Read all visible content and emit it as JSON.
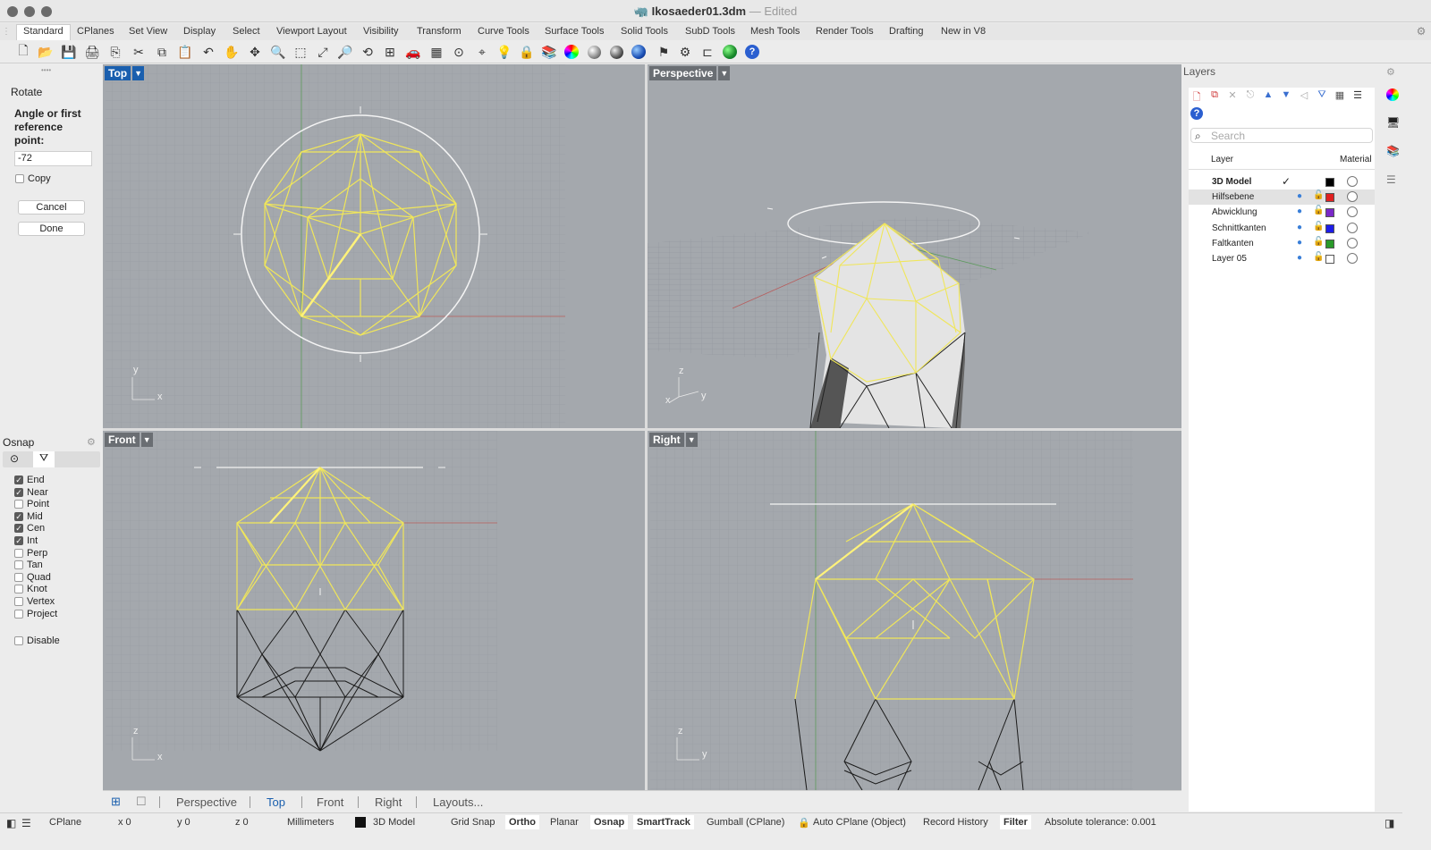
{
  "window": {
    "title": "Ikosaeder01.3dm",
    "status": "Edited"
  },
  "tabs": [
    "Standard",
    "CPlanes",
    "Set View",
    "Display",
    "Select",
    "Viewport Layout",
    "Visibility",
    "Transform",
    "Curve Tools",
    "Surface Tools",
    "Solid Tools",
    "SubD Tools",
    "Mesh Tools",
    "Render Tools",
    "Drafting",
    "New in V8"
  ],
  "command": {
    "name": "Rotate",
    "prompt": "Angle or first reference point:",
    "value": "-72",
    "copy_label": "Copy",
    "copy_checked": false,
    "cancel_label": "Cancel",
    "done_label": "Done"
  },
  "osnap": {
    "title": "Osnap",
    "items": [
      {
        "label": "End",
        "checked": true
      },
      {
        "label": "Near",
        "checked": true
      },
      {
        "label": "Point",
        "checked": false
      },
      {
        "label": "Mid",
        "checked": true
      },
      {
        "label": "Cen",
        "checked": true
      },
      {
        "label": "Int",
        "checked": true
      },
      {
        "label": "Perp",
        "checked": false
      },
      {
        "label": "Tan",
        "checked": false
      },
      {
        "label": "Quad",
        "checked": false
      },
      {
        "label": "Knot",
        "checked": false
      },
      {
        "label": "Vertex",
        "checked": false
      },
      {
        "label": "Project",
        "checked": false
      }
    ],
    "disable_label": "Disable"
  },
  "viewports": {
    "top": {
      "label": "Top",
      "axes": {
        "a": "y",
        "b": "x"
      }
    },
    "perspective": {
      "label": "Perspective",
      "axes": {
        "a": "z",
        "b": "y",
        "c": "x"
      }
    },
    "front": {
      "label": "Front",
      "axes": {
        "a": "z",
        "b": "x"
      }
    },
    "right": {
      "label": "Right",
      "axes": {
        "a": "z",
        "b": "y"
      }
    }
  },
  "viewport_tabs": [
    "Perspective",
    "Top",
    "Front",
    "Right",
    "Layouts..."
  ],
  "active_viewport_tab": "Top",
  "layers": {
    "title": "Layers",
    "search_placeholder": "Search",
    "col_layer": "Layer",
    "col_material": "Material",
    "rows": [
      {
        "name": "3D Model",
        "color": "#000000",
        "current": true
      },
      {
        "name": "Hilfsebene",
        "color": "#e02020",
        "selected": true
      },
      {
        "name": "Abwicklung",
        "color": "#7a28c8"
      },
      {
        "name": "Schnittkanten",
        "color": "#1d1de8"
      },
      {
        "name": "Faltkanten",
        "color": "#2a9a2a"
      },
      {
        "name": "Layer 05",
        "color": "#ffffff"
      }
    ]
  },
  "statusbar": {
    "cplane": "CPlane",
    "x": "x 0",
    "y": "y 0",
    "z": "z 0",
    "units": "Millimeters",
    "layer": "3D Model",
    "grid_snap": "Grid Snap",
    "ortho": "Ortho",
    "planar": "Planar",
    "osnap": "Osnap",
    "smarttrack": "SmartTrack",
    "gumball": "Gumball (CPlane)",
    "autocplane": "Auto CPlane (Object)",
    "record_history": "Record History",
    "filter": "Filter",
    "tolerance": "Absolute tolerance: 0.001"
  },
  "icons": [
    "new-icon",
    "open-icon",
    "save-icon",
    "print-icon",
    "import-icon",
    "cut-icon",
    "copy-icon",
    "paste-icon",
    "undo-icon",
    "pan-icon",
    "rotate-view-icon",
    "zoom-icon",
    "zoom-window-icon",
    "zoom-extents-icon",
    "zoom-selected-icon",
    "undo-view-icon",
    "four-viewports-icon",
    "car-icon",
    "grid-icon",
    "cplane-icon",
    "osnap-icon",
    "light-icon",
    "lock-icon",
    "layer-icon",
    "color-wheel-icon",
    "sphere-shaded-icon",
    "render-icon",
    "globe-icon",
    "flag-icon",
    "gear-icon",
    "tree-icon",
    "earth-icon",
    "help-icon"
  ]
}
